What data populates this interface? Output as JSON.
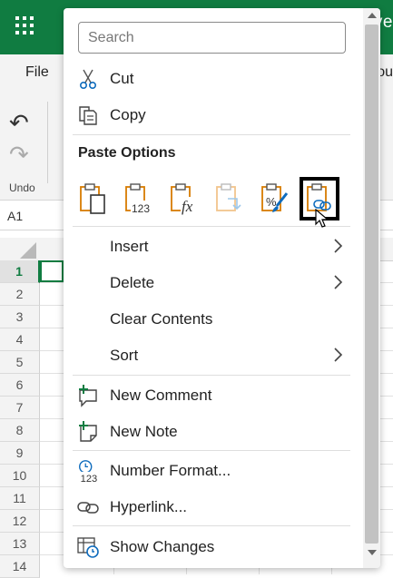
{
  "app": {
    "top_right_text": "rive",
    "tab_file": "File",
    "tab_right": "ou",
    "undo_label": "Undo",
    "name_box": "A1",
    "row_numbers": [
      "1",
      "2",
      "3",
      "4",
      "5",
      "6",
      "7",
      "8",
      "9",
      "10",
      "11",
      "12",
      "13",
      "14"
    ],
    "accent_color": "#107c41"
  },
  "menu": {
    "search_placeholder": "Search",
    "cut_label": "Cut",
    "copy_label": "Copy",
    "paste_options_title": "Paste Options",
    "paste_options": [
      {
        "icon": "paste-icon"
      },
      {
        "icon": "paste-values-icon",
        "glyph": "123"
      },
      {
        "icon": "paste-formulas-icon",
        "glyph": "fx"
      },
      {
        "icon": "paste-transpose-icon"
      },
      {
        "icon": "paste-formatting-icon",
        "glyph": "%"
      },
      {
        "icon": "paste-link-icon"
      }
    ],
    "insert_label": "Insert",
    "delete_label": "Delete",
    "clear_label": "Clear Contents",
    "sort_label": "Sort",
    "new_comment_label": "New Comment",
    "new_note_label": "New Note",
    "number_format_label": "Number Format...",
    "hyperlink_label": "Hyperlink...",
    "show_changes_label": "Show Changes",
    "number_format_glyph": "123"
  }
}
